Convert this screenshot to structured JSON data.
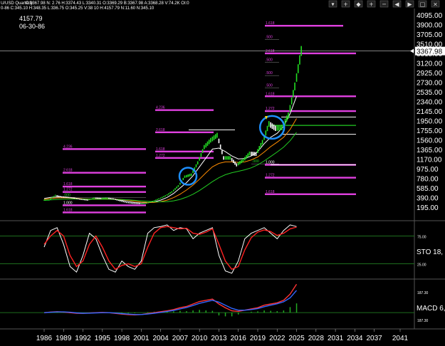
{
  "header": {
    "symbol": "U/USD Quarterly",
    "ohlc_line1": "C:3367.98  N: 2.76  H:3374.43  L:3340.31  O:3369.29  B:3367.98  A:3368.28  V:74.2K  OI:0",
    "ohlc_line2": "0-86  C:345.10  H:348.35  L:336.75  O:345.25  V:38 10  H:4157.79  N:11.60  N:345.10",
    "price_label": "4157.79",
    "date_label": "06-30-86"
  },
  "toolbar": {
    "icons": [
      "pin-icon",
      "crosshair-icon",
      "diamond-icon",
      "zoom-in-icon",
      "zoom-out-icon",
      "arrow-left-icon",
      "arrow-right-icon",
      "restore-icon",
      "close-icon"
    ]
  },
  "colors": {
    "background": "#000000",
    "price_up": "#22dd22",
    "price_down": "#ffffff",
    "fib_line": "#e040e0",
    "ma_fast": "#ffffff",
    "ma_mid": "#ff8c00",
    "ma_slow": "#22cc22",
    "stoch_k": "#ffffff",
    "stoch_d": "#ff2222",
    "macd_line": "#ff3333",
    "macd_signal": "#3366ff",
    "circle": "#1e90ff",
    "grid": "#1e6e1e"
  },
  "chart_data": [
    {
      "type": "line",
      "name": "price-pane",
      "y_ticks": [
        4095,
        3900,
        3705,
        3510,
        3315,
        3120,
        2925,
        2730,
        2535,
        2340,
        2145,
        1950,
        1755,
        1560,
        1365,
        1170,
        975,
        780,
        585,
        390,
        195
      ],
      "y_ticks_labels": [
        "4095.00",
        "3900.00",
        "3705.00",
        "3510.00",
        "3315.00",
        "3120.00",
        "2925.00",
        "2730.00",
        "2535.00",
        "2340.00",
        "2145.00",
        "1950.00",
        "1755.00",
        "1560.00",
        "1365.00",
        "1170.00",
        "975.00",
        "780.00",
        "585.00",
        "390.00",
        "195.00"
      ],
      "ylim": [
        0,
        4200
      ],
      "last_price_label": "3367.98",
      "last_price": 3367.98,
      "x_ticks": [
        "1986",
        "1989",
        "1992",
        "1995",
        "1998",
        "2001",
        "2004",
        "2007",
        "2010",
        "2013",
        "2016",
        "2019",
        "2022",
        "2025",
        "2028",
        "2031",
        "2034",
        "2037",
        "2041"
      ],
      "x": [
        1986,
        1987,
        1988,
        1989,
        1990,
        1991,
        1992,
        1993,
        1994,
        1995,
        1996,
        1997,
        1998,
        1999,
        2000,
        2001,
        2002,
        2003,
        2004,
        2005,
        2006,
        2007,
        2008,
        2009,
        2010,
        2011,
        2012,
        2013,
        2014,
        2015,
        2016,
        2017,
        2018,
        2019,
        2020,
        2021,
        2022,
        2023,
        2024,
        2025
      ],
      "values": [
        345,
        440,
        410,
        400,
        385,
        360,
        345,
        385,
        380,
        385,
        370,
        330,
        295,
        280,
        275,
        280,
        320,
        370,
        430,
        510,
        630,
        820,
        860,
        1100,
        1420,
        1560,
        1660,
        1200,
        1200,
        1060,
        1150,
        1290,
        1280,
        1520,
        1890,
        1800,
        1820,
        2060,
        2650,
        3367.98
      ],
      "series": [
        {
          "name": "MA fast",
          "values": [
            380,
            400,
            410,
            405,
            395,
            380,
            365,
            365,
            370,
            375,
            372,
            360,
            340,
            315,
            295,
            285,
            290,
            310,
            345,
            400,
            480,
            590,
            700,
            840,
            1020,
            1200,
            1380,
            1400,
            1330,
            1240,
            1180,
            1190,
            1240,
            1330,
            1490,
            1620,
            1700,
            1840,
            2100,
            2450
          ]
        },
        {
          "name": "MA mid",
          "values": [
            360,
            380,
            390,
            392,
            390,
            382,
            372,
            368,
            368,
            370,
            370,
            365,
            355,
            340,
            322,
            305,
            298,
            300,
            315,
            345,
            395,
            465,
            550,
            650,
            770,
            900,
            1020,
            1090,
            1120,
            1120,
            1110,
            1120,
            1160,
            1220,
            1320,
            1430,
            1520,
            1620,
            1780,
            2000
          ]
        },
        {
          "name": "MA slow",
          "values": [
            340,
            350,
            360,
            365,
            368,
            368,
            366,
            364,
            362,
            362,
            362,
            360,
            356,
            350,
            340,
            330,
            320,
            312,
            310,
            315,
            330,
            360,
            405,
            465,
            540,
            630,
            720,
            800,
            860,
            900,
            930,
            960,
            1000,
            1060,
            1140,
            1230,
            1320,
            1420,
            1550,
            1720
          ]
        }
      ],
      "fib_labels": [
        {
          "text": "1.618",
          "y": 3880
        },
        {
          "text": ".500",
          "y": 3600
        },
        {
          "text": "2.618",
          "y": 3320
        },
        {
          "text": ".500",
          "y": 3140
        },
        {
          "text": ".500",
          "y": 2870
        },
        {
          "text": ".500",
          "y": 2620
        },
        {
          "text": "1.618",
          "y": 2450
        },
        {
          "text": "1.272",
          "y": 2150
        },
        {
          "text": "4.236",
          "y": 2170
        },
        {
          "text": "2.618",
          "y": 1720
        },
        {
          "text": "1.618",
          "y": 1330
        },
        {
          "text": "1.272",
          "y": 1200
        },
        {
          "text": ".000",
          "y": 1080
        },
        {
          "text": "4.236",
          "y": 1380
        },
        {
          "text": "2.618",
          "y": 900
        },
        {
          "text": "1.618",
          "y": 620
        },
        {
          "text": "1.272",
          "y": 510
        },
        {
          "text": ".000",
          "y": 400
        },
        {
          "text": "1.000",
          "y": 240
        },
        {
          "text": "1.618",
          "y": 95
        },
        {
          "text": "1.000",
          "y": 1060
        },
        {
          "text": "1.272",
          "y": 800
        },
        {
          "text": "1.618",
          "y": 465
        }
      ],
      "annotations": {
        "circle_1_year": 2008,
        "circle_1_price": 830,
        "circle_2_year": 2021,
        "circle_2_price": 1820
      }
    },
    {
      "type": "line",
      "name": "stochastic-pane",
      "label": "STO  18,",
      "y_ticks_labels": [
        "75.00",
        "25.00"
      ],
      "ylim": [
        0,
        100
      ],
      "series": [
        {
          "name": "%K",
          "values": [
            55,
            85,
            90,
            60,
            20,
            10,
            40,
            80,
            70,
            40,
            15,
            10,
            30,
            20,
            15,
            30,
            80,
            90,
            92,
            95,
            85,
            90,
            88,
            70,
            80,
            85,
            90,
            40,
            12,
            8,
            30,
            70,
            80,
            85,
            90,
            80,
            70,
            85,
            95,
            92
          ]
        },
        {
          "name": "%D",
          "values": [
            60,
            75,
            85,
            75,
            40,
            20,
            30,
            60,
            75,
            55,
            30,
            15,
            22,
            25,
            20,
            25,
            55,
            80,
            90,
            92,
            90,
            88,
            89,
            80,
            78,
            82,
            88,
            60,
            30,
            15,
            20,
            50,
            72,
            82,
            86,
            83,
            76,
            80,
            88,
            91
          ]
        }
      ]
    },
    {
      "type": "line",
      "name": "macd-pane",
      "label": "MACD 6,",
      "y_ticks_labels": [
        "187.30",
        "187.30"
      ],
      "ylim": [
        -120,
        260
      ],
      "series": [
        {
          "name": "MACD",
          "values": [
            0,
            5,
            8,
            5,
            0,
            -5,
            -6,
            -3,
            0,
            2,
            0,
            -6,
            -12,
            -16,
            -18,
            -15,
            -8,
            0,
            8,
            15,
            25,
            40,
            50,
            70,
            90,
            100,
            110,
            70,
            40,
            15,
            10,
            20,
            30,
            40,
            60,
            70,
            80,
            100,
            150,
            230
          ]
        },
        {
          "name": "Signal",
          "values": [
            0,
            3,
            6,
            6,
            3,
            -2,
            -5,
            -4,
            -2,
            0,
            0,
            -3,
            -8,
            -12,
            -15,
            -15,
            -11,
            -5,
            2,
            10,
            18,
            30,
            42,
            58,
            75,
            88,
            100,
            85,
            60,
            35,
            20,
            20,
            25,
            33,
            48,
            60,
            72,
            88,
            120,
            180
          ]
        }
      ]
    }
  ]
}
